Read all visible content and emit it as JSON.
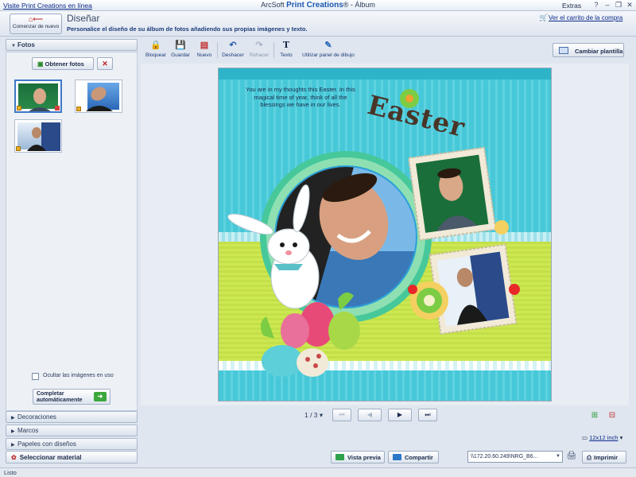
{
  "titlebar": {
    "web_link": "Visite Print Creations en línea",
    "app_vendor": "ArcSoft ",
    "app_brand": "Print Creations",
    "app_suffix": "® - Álbum",
    "extras_menu": "Extras"
  },
  "header": {
    "restart_label": "Comenzar de nuevo",
    "step_title": "Diseñar",
    "step_description": "Personalice el diseño de su álbum de fotos añadiendo sus propias imágenes y texto.",
    "cart_link": "Ver el carrito de la compra"
  },
  "left_panel": {
    "photos_section": "Fotos",
    "get_photos_button": "Obtener fotos",
    "hide_used_label": "Ocultar las imágenes en uso",
    "hide_used_checked": false,
    "auto_complete_line1": "Completar",
    "auto_complete_line2": "automáticamente",
    "sections": [
      {
        "label": "Decoraciones"
      },
      {
        "label": "Marcos"
      },
      {
        "label": "Papeles con diseños"
      }
    ],
    "select_material": "Seleccionar material"
  },
  "toolbar": {
    "tools": [
      {
        "label": "Bloquear",
        "icon": "lock-icon",
        "enabled": true
      },
      {
        "label": "Guardar",
        "icon": "save-icon",
        "enabled": true
      },
      {
        "label": "Nuevo",
        "icon": "new-icon",
        "enabled": true
      },
      {
        "label": "Deshacer",
        "icon": "undo-icon",
        "enabled": true
      },
      {
        "label": "Rehacer",
        "icon": "redo-icon",
        "enabled": false
      },
      {
        "label": "Texto",
        "icon": "text-icon",
        "enabled": true
      },
      {
        "label": "Utilizar panel de dibujo",
        "icon": "drawing-panel-icon",
        "enabled": true
      }
    ],
    "change_template_button": "Cambiar plantilla"
  },
  "canvas": {
    "poem_text": "You are in my thoughts this Easter. In this magical time of year, think of all the blessings we have in our lives.",
    "title_text": "Easter"
  },
  "navigation": {
    "page_indicator": "1 / 3",
    "zoom_label": "12x12 inch"
  },
  "bottom_bar": {
    "preview_button": "Vista previa",
    "share_button": "Compartir",
    "printer_path": "\\\\172.20.60.249\\NRG_B6...",
    "print_button": "Imprimir"
  },
  "status": {
    "text": "Listo"
  },
  "colors": {
    "page_cyan": "#47c8d8",
    "page_green": "#cde852",
    "frame_green": "#5ccf74",
    "accent_blue": "#1a57b0"
  }
}
